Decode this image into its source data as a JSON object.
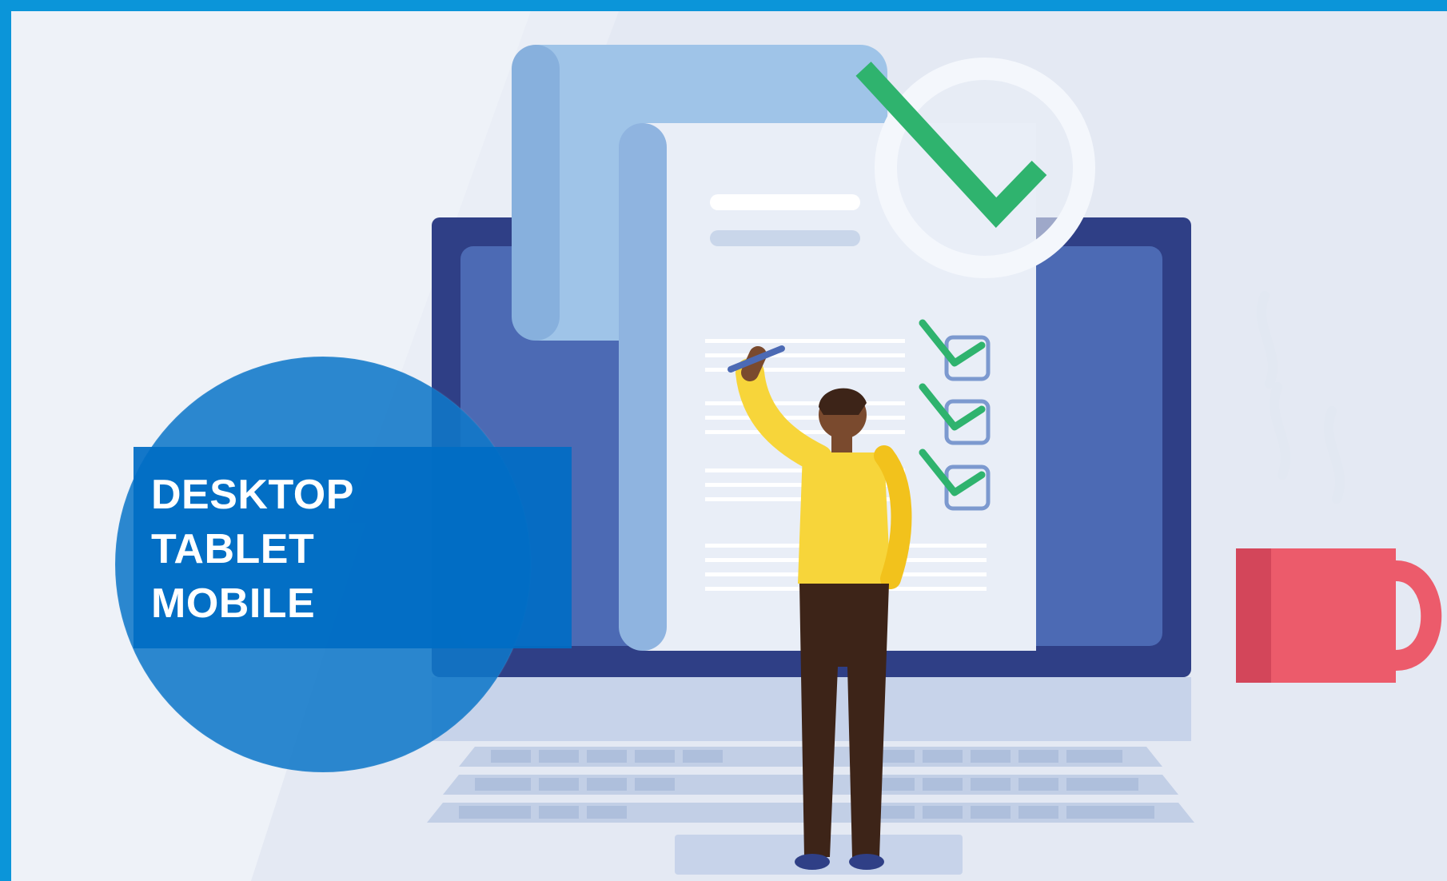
{
  "colors": {
    "frame_border": "#0b95d9",
    "background": "#eef2f8",
    "laptop_frame": "#2f3f86",
    "laptop_screen": "#4c6ab4",
    "document": "#e9eef7",
    "document_back": "#9fc4e8",
    "check_green": "#2fb36e",
    "circle_overlay": "#1f86d2",
    "label_box": "#006cc4",
    "shirt": "#f7d53a",
    "pants": "#3d2418",
    "mug": "#ec5b6b"
  },
  "icons": {
    "large_check": "check-mark-icon",
    "checklist": "checkbox-checked-icon",
    "mug": "coffee-mug-icon",
    "person": "person-illustration",
    "laptop": "laptop-illustration",
    "document": "document-illustration"
  },
  "label": {
    "lines": [
      "DESKTOP",
      "TABLET",
      "MOBILE"
    ]
  }
}
